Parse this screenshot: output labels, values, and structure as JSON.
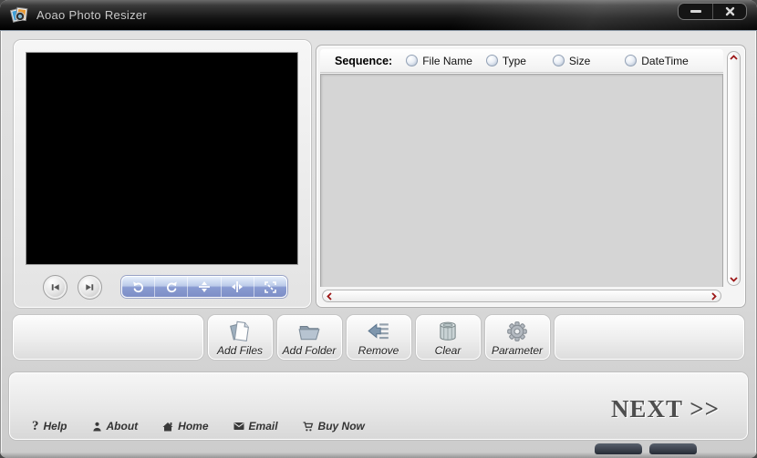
{
  "titlebar": {
    "title": "Aoao Photo Resizer",
    "app_icon": "photo-resizer-app-icon",
    "minimize_icon": "minimize-icon",
    "close_icon": "close-icon"
  },
  "preview": {
    "transport": [
      {
        "icon": "skip-previous-icon"
      },
      {
        "icon": "skip-next-icon"
      }
    ],
    "tools": [
      {
        "icon": "rotate-left-icon"
      },
      {
        "icon": "rotate-right-icon"
      },
      {
        "icon": "flip-vertical-icon"
      },
      {
        "icon": "flip-horizontal-icon"
      },
      {
        "icon": "fit-screen-icon"
      }
    ]
  },
  "sequence": {
    "label": "Sequence:",
    "options": [
      {
        "label": "File Name",
        "selected": false
      },
      {
        "label": "Type",
        "selected": false
      },
      {
        "label": "Size",
        "selected": false
      },
      {
        "label": "DateTime",
        "selected": false
      }
    ]
  },
  "list": {
    "items": []
  },
  "toolbar": {
    "buttons": [
      {
        "label": "Add Files",
        "icon": "add-files-icon"
      },
      {
        "label": "Add Folder",
        "icon": "add-folder-icon"
      },
      {
        "label": "Remove",
        "icon": "remove-icon"
      },
      {
        "label": "Clear",
        "icon": "clear-icon"
      },
      {
        "label": "Parameter",
        "icon": "parameter-icon"
      }
    ]
  },
  "footer": {
    "links": [
      {
        "label": "Help",
        "icon": "help-icon",
        "glyph": "?"
      },
      {
        "label": "About",
        "icon": "about-icon"
      },
      {
        "label": "Home",
        "icon": "home-icon"
      },
      {
        "label": "Email",
        "icon": "email-icon"
      },
      {
        "label": "Buy Now",
        "icon": "buy-now-icon"
      }
    ],
    "next_label": "NEXT >>"
  },
  "colors": {
    "titlebar_bg": "#111111",
    "toolbar_blue": "#8190c8",
    "scroll_arrow_red": "#9c1616",
    "list_bg": "#d5d5d5"
  }
}
